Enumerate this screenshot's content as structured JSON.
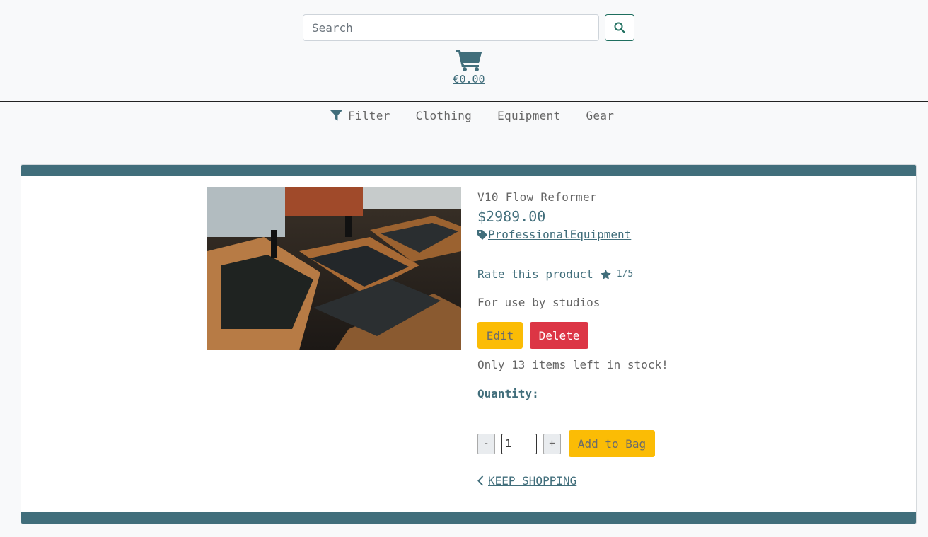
{
  "search": {
    "placeholder": "Search"
  },
  "cart": {
    "total": "€0.00"
  },
  "nav": {
    "filter_label": "Filter",
    "items": [
      "Clothing",
      "Equipment",
      "Gear"
    ]
  },
  "product": {
    "name": "V10 Flow Reformer",
    "price": "$2989.00",
    "category": "ProfessionalEquipment",
    "rate_label": "Rate this product",
    "rating": "1/5",
    "description": "For use by studios",
    "edit_label": "Edit",
    "delete_label": "Delete",
    "stock_text": "Only 13 items left in stock!",
    "quantity_label": "Quantity:",
    "quantity_value": "1",
    "decrement_label": "-",
    "increment_label": "+",
    "add_label": "Add to Bag",
    "keep_shopping_label": "KEEP SHOPPING"
  },
  "colors": {
    "accent": "#416e7b",
    "warning": "#fbbc05",
    "danger": "#dc3545",
    "search_border": "#1e6e5e"
  },
  "icons": [
    "search-icon",
    "cart-icon",
    "filter-icon",
    "tag-icon",
    "star-icon",
    "chevron-left-icon"
  ]
}
